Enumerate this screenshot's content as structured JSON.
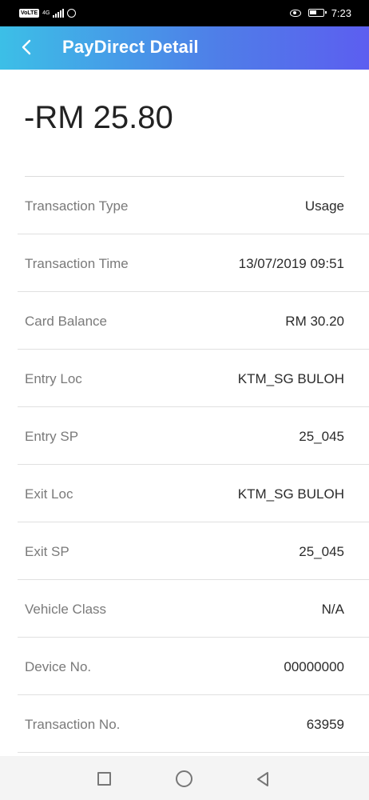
{
  "status_bar": {
    "volte": "VoLTE",
    "network": "4G",
    "time": "7:23"
  },
  "header": {
    "title": "PayDirect Detail",
    "back_icon": "chevron-left-icon"
  },
  "amount": "-RM 25.80",
  "details": [
    {
      "label": "Transaction Type",
      "value": "Usage"
    },
    {
      "label": "Transaction Time",
      "value": "13/07/2019 09:51"
    },
    {
      "label": "Card Balance",
      "value": "RM 30.20"
    },
    {
      "label": "Entry Loc",
      "value": "KTM_SG BULOH"
    },
    {
      "label": "Entry SP",
      "value": "25_045"
    },
    {
      "label": "Exit Loc",
      "value": "KTM_SG BULOH"
    },
    {
      "label": "Exit SP",
      "value": "25_045"
    },
    {
      "label": "Vehicle Class",
      "value": "N/A"
    },
    {
      "label": "Device No.",
      "value": "00000000"
    },
    {
      "label": "Transaction No.",
      "value": "63959"
    }
  ],
  "nav": {
    "recent_icon": "square-icon",
    "home_icon": "circle-icon",
    "back_icon": "triangle-back-icon"
  },
  "colors": {
    "header_gradient_start": "#3cbfe7",
    "header_gradient_end": "#5c5ef0",
    "label_gray": "#7a7a7a",
    "value_dark": "#2b2b2b"
  }
}
